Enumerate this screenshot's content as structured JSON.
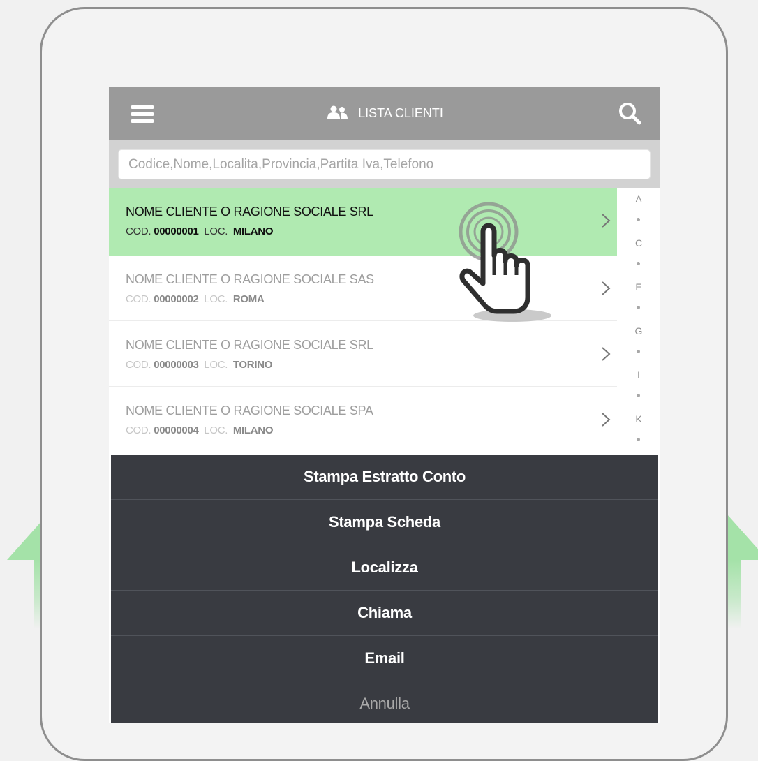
{
  "colors": {
    "page_background": "#f1f1f1",
    "device_frame": "#8e8e8e",
    "app_bar": "#9a9a9a",
    "search_bar_background": "#d2d2d2",
    "selected_row": "#b0eab1",
    "action_sheet": "#393b41",
    "arrow_green": "#a4e2a8"
  },
  "app_bar": {
    "menu_icon": "hamburger-menu-icon",
    "title_icon": "people-icon",
    "title": "LISTA CLIENTI",
    "search_icon": "search-icon"
  },
  "search": {
    "placeholder": "Codice,Nome,Localita,Provincia,Partita Iva,Telefono",
    "value": ""
  },
  "clients": [
    {
      "name": "NOME CLIENTE O RAGIONE SOCIALE SRL",
      "cod_label": "COD.",
      "code": "00000001",
      "loc_label": "LOC.",
      "location": "MILANO",
      "selected": true
    },
    {
      "name": "NOME CLIENTE O RAGIONE SOCIALE SAS",
      "cod_label": "COD.",
      "code": "00000002",
      "loc_label": "LOC.",
      "location": "ROMA",
      "selected": false
    },
    {
      "name": "NOME CLIENTE O RAGIONE SOCIALE SRL",
      "cod_label": "COD.",
      "code": "00000003",
      "loc_label": "LOC.",
      "location": "TORINO",
      "selected": false
    },
    {
      "name": "NOME CLIENTE O RAGIONE SOCIALE SPA",
      "cod_label": "COD.",
      "code": "00000004",
      "loc_label": "LOC.",
      "location": "MILANO",
      "selected": false
    }
  ],
  "alphabet_index": [
    "A",
    "C",
    "E",
    "G",
    "I",
    "K"
  ],
  "action_sheet": {
    "items": [
      "Stampa Estratto Conto",
      "Stampa Scheda",
      "Localizza",
      "Chiama",
      "Email"
    ],
    "cancel": "Annulla"
  },
  "decorations": {
    "tap_gesture_icon": "tap-hand-icon",
    "side_arrows": "up-arrow-icon"
  }
}
